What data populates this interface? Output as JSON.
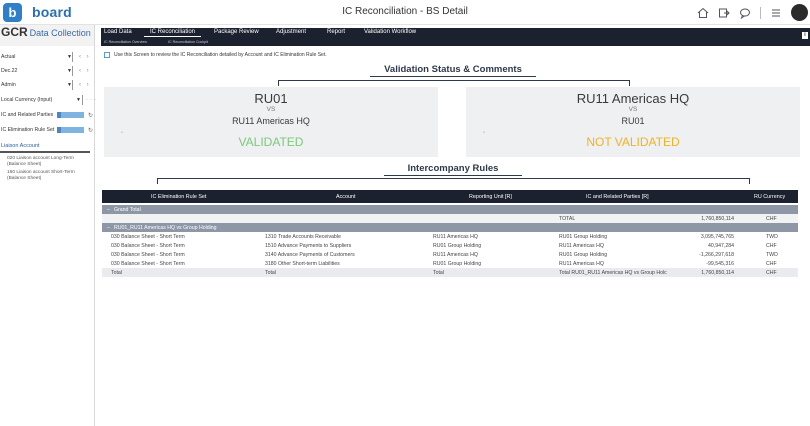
{
  "app": {
    "logo_letter": "b",
    "logo_text": "board",
    "title": "IC Reconciliation - BS Detail"
  },
  "topbar_icons": [
    "home-icon",
    "export-icon",
    "comment-icon",
    "menu-icon",
    "avatar"
  ],
  "left_panel": {
    "header_bold": "GCR",
    "header_rest": "Data Collection",
    "selectors": [
      {
        "label": "Actual",
        "type": "dropdown"
      },
      {
        "label": "Dec.22",
        "type": "dropdown"
      },
      {
        "label": "Admin",
        "type": "dropdown"
      },
      {
        "label": "Local Currency (Input)",
        "type": "dropdown-more"
      },
      {
        "label": "IC and Related Parties",
        "type": "progress"
      },
      {
        "label": "IC Elimination Rule Set",
        "type": "progress"
      }
    ],
    "liaison_title": "Liaison Account",
    "liaison_items": [
      "020 Liaison account Long-Term (Balance Sheet)",
      "160 Liaison account Short-Term (Balance Sheet)"
    ]
  },
  "nav": {
    "tabs": [
      "Load Data",
      "IC Reconciliation",
      "Package Review",
      "Adjustment",
      "Report",
      "Validation Workflow"
    ],
    "active_tab": "IC Reconciliation",
    "subtabs": [
      "IC Reconciliation Overview",
      "IC Reconciliation Cockpit"
    ]
  },
  "instruction": "Use this Screen to review the IC Reconciliation detailed by Account and IC Elimination Rule Set.",
  "validation": {
    "title": "Validation Status & Comments",
    "cards": [
      {
        "entity": "RU01",
        "vs": "VS",
        "counterpart": "RU11 Americas HQ",
        "status": "VALIDATED",
        "status_color": "#7cc97a"
      },
      {
        "entity": "RU11 Americas HQ",
        "vs": "VS",
        "counterpart": "RU01",
        "status": "NOT VALIDATED",
        "status_color": "#f0b322"
      }
    ]
  },
  "rules": {
    "title": "Intercompany Rules",
    "columns": [
      "IC Elimination Rule Set",
      "Account",
      "Reporting Unit [R]",
      "IC and Related Parties [R]",
      "RU Currency"
    ],
    "grand_total_label": "Grand Total",
    "grand_total_row": {
      "label": "TOTAL",
      "amount": "1,760,850,114",
      "currency": "CHF"
    },
    "group_label": "RU01_RU11 Americas HQ vs Group Holding",
    "rows": [
      {
        "rule": "030 Balance Sheet - Short Term",
        "account": "1310 Trade Accounts Receivable",
        "ru": "RU11 Americas HQ",
        "ic": "RU01 Group Holding",
        "amount": "3,095,745,765",
        "currency": "TWD"
      },
      {
        "rule": "030 Balance Sheet - Short Term",
        "account": "1510 Advance Payments to Suppliers",
        "ru": "RU01 Group Holding",
        "ic": "RU11 Americas HQ",
        "amount": "40,947,284",
        "currency": "CHF"
      },
      {
        "rule": "030 Balance Sheet - Short Term",
        "account": "3140 Advance Payments of Customers",
        "ru": "RU11 Americas HQ",
        "ic": "RU01 Group Holding",
        "amount": "-1,266,297,618",
        "currency": "TWD"
      },
      {
        "rule": "030 Balance Sheet - Short Term",
        "account": "3180 Other Short-term Liabilities",
        "ru": "RU01 Group Holding",
        "ic": "RU11 Americas HQ",
        "amount": "-99,545,316",
        "currency": "CHF"
      }
    ],
    "total_row": {
      "rule": "Total",
      "account": "Total",
      "ru": "Total",
      "ic": "Total RU01_RU11 Americas HQ vs Group Holc",
      "amount": "1,760,850,114",
      "currency": "CHF"
    }
  }
}
